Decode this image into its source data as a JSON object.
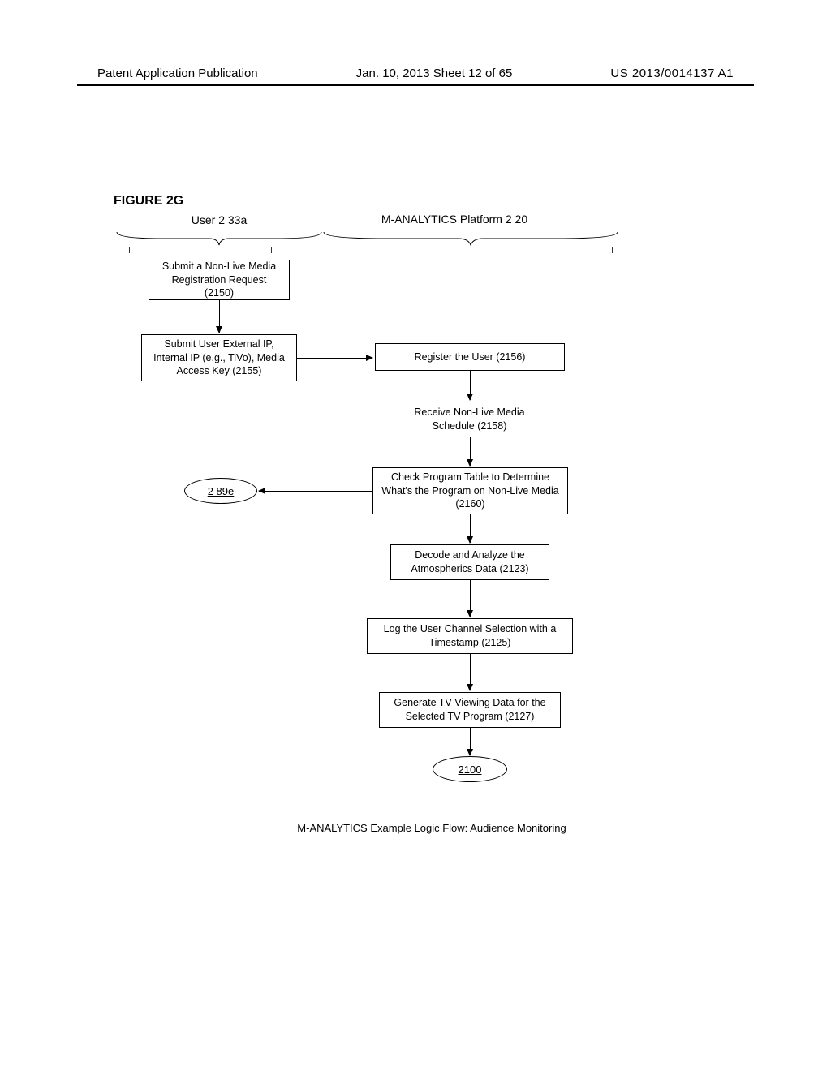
{
  "header": {
    "left": "Patent Application Publication",
    "mid": "Jan. 10, 2013   Sheet 12 of 65",
    "right": "US 2013/0014137 A1"
  },
  "figure_label": "FIGURE 2G",
  "lanes": {
    "user": "User 2 33a",
    "platform": "M-ANALYTICS  Platform 2 20"
  },
  "boxes": {
    "b2150": "Submit a Non-Live Media Registration Request (2150)",
    "b2155": "Submit User External IP, Internal IP (e.g., TiVo), Media Access Key (2155)",
    "b2156": "Register the User (2156)",
    "b2158": "Receive Non-Live Media Schedule (2158)",
    "b2160": "Check Program Table to Determine What's the Program on Non-Live Media (2160)",
    "b2123": "Decode and Analyze the Atmospherics Data (2123)",
    "b2125": "Log the User Channel Selection with a Timestamp  (2125)",
    "b2127": "Generate TV Viewing Data for the Selected TV Program (2127)"
  },
  "ellipses": {
    "e289e": "2 89e",
    "e2100": "2100"
  },
  "caption": "M-ANALYTICS Example Logic Flow: Audience Monitoring"
}
